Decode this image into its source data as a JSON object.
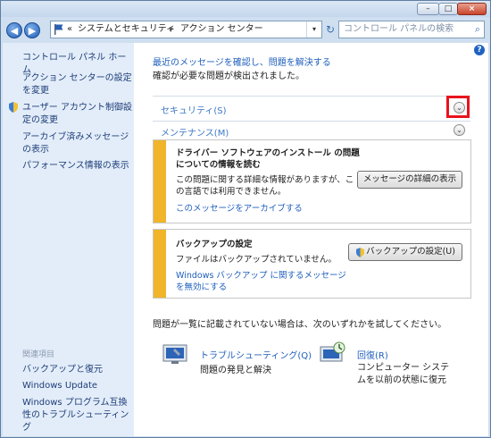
{
  "window": {
    "controls": {
      "minimize": "–",
      "maximize": "□",
      "close": "×"
    }
  },
  "nav": {
    "back": "◀",
    "forward": "▶",
    "breadcrumb_prefix": "«",
    "breadcrumb_1": "システムとセキュリティ",
    "breadcrumb_sep": "▸",
    "breadcrumb_2": "アクション センター",
    "dropdown": "▾",
    "refresh": "↻",
    "search_placeholder": "コントロール パネルの検索",
    "search_icon": "⌕"
  },
  "sidebar": {
    "home": "コントロール パネル ホーム",
    "items": [
      "アクション センターの設定を変更",
      "ユーザー アカウント制御設定の変更",
      "アーカイブ済みメッセージの表示",
      "パフォーマンス情報の表示"
    ],
    "related_header": "関連項目",
    "related": [
      "バックアップと復元",
      "Windows Update",
      "Windows プログラム互換性のトラブルシューティング"
    ]
  },
  "main": {
    "help": "?",
    "intro_link": "最近のメッセージを確認し、問題を解決する",
    "intro_text": "確認が必要な問題が検出されました。",
    "security_label": "セキュリティ(S)",
    "maintenance_label": "メンテナンス(M)",
    "chevron": "⌄",
    "driver_card": {
      "title": "ドライバー ソフトウェアのインストール の問題についての情報を読む",
      "body": "この問題に関する詳細な情報がありますが、この言語では利用できません。",
      "archive_link": "このメッセージをアーカイブする",
      "button": "メッセージの詳細の表示"
    },
    "backup_card": {
      "title": "バックアップの設定",
      "body": "ファイルはバックアップされていません。",
      "link": "Windows バックアップ に関するメッセージを無効にする",
      "button": "バックアップの設定(U)"
    },
    "footer_text": "問題が一覧に記載されていない場合は、次のいずれかを試してください。",
    "troubleshoot": {
      "title": "トラブルシューティング(Q)",
      "desc": "問題の発見と解決"
    },
    "recovery": {
      "title": "回復(R)",
      "desc": "コンピューター システムを以前の状態に復元"
    }
  }
}
